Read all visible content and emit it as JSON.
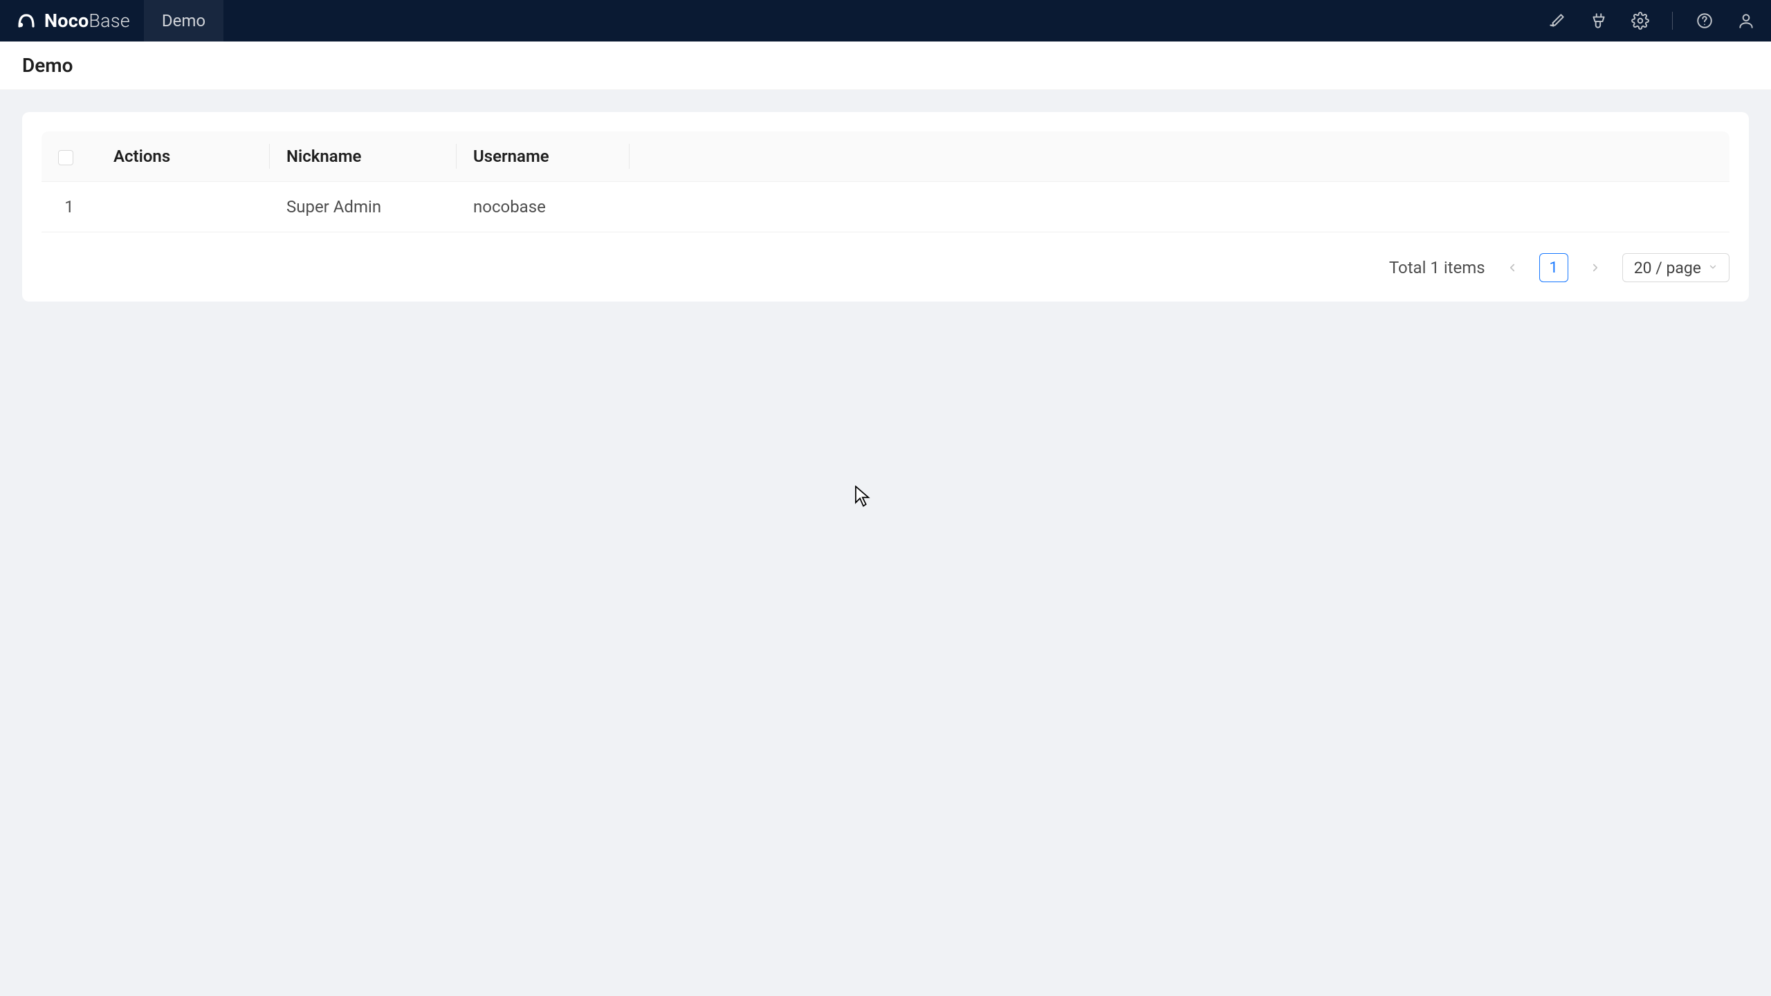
{
  "brand": {
    "name_bold": "Noco",
    "name_light": "Base"
  },
  "nav": {
    "tab": "Demo"
  },
  "page": {
    "title": "Demo"
  },
  "table": {
    "headers": {
      "actions": "Actions",
      "nickname": "Nickname",
      "username": "Username"
    },
    "rows": [
      {
        "index": "1",
        "nickname": "Super Admin",
        "username": "nocobase"
      }
    ]
  },
  "pagination": {
    "total_text": "Total 1 items",
    "current": "1",
    "page_size": "20 / page"
  }
}
